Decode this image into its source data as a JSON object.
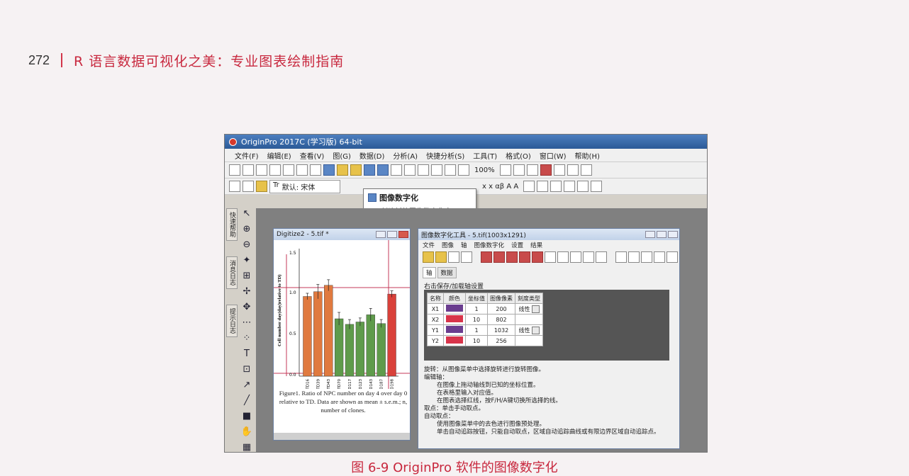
{
  "page": {
    "page_number": "272",
    "book_title": "R 语言数据可视化之美：专业图表绘制指南",
    "caption": "图 6-9 OriginPro 软件的图像数字化"
  },
  "app": {
    "title": "OriginPro 2017C (学习版) 64-bit",
    "menu": [
      "文件(F)",
      "编辑(E)",
      "查看(V)",
      "图(G)",
      "数据(D)",
      "分析(A)",
      "快捷分析(S)",
      "工具(T)",
      "格式(O)",
      "窗口(W)",
      "帮助(H)"
    ],
    "zoom": "100%",
    "font_name": "默认: 宋体",
    "format_symbols": "x  x  αβ  A  A"
  },
  "tooltip": {
    "title": "图像数字化",
    "description": "创建新的图像数字化窗口"
  },
  "side_tabs": [
    "快速帮助",
    "消息日志",
    "提示日志"
  ],
  "graph_window": {
    "title": "Digitize2 - 5.tif *",
    "y_label": "Cell number day(day)relative to TD)",
    "y_ticks": [
      "1.5",
      "1.0",
      "0.5",
      "0.0"
    ],
    "figure_caption": "Figure1. Ratio of NPC number on day 4 over day 0 relative to TD. Data are shown as mean ± s.e.m.; n, number of clones."
  },
  "chart_data": {
    "type": "bar",
    "categories": [
      "TD16",
      "TD39",
      "TD43",
      "TD70",
      "TD117",
      "TD123",
      "TD143",
      "TD187",
      "TD198"
    ],
    "values": [
      1.0,
      1.06,
      1.14,
      0.72,
      0.65,
      0.68,
      0.77,
      0.66,
      1.03
    ],
    "errors": [
      0.04,
      0.09,
      0.07,
      0.08,
      0.06,
      0.05,
      0.08,
      0.05,
      0.04
    ],
    "ylim": [
      0,
      1.6
    ],
    "colors": [
      "#e07a3f",
      "#e07a3f",
      "#e07a3f",
      "#5f9b4b",
      "#5f9b4b",
      "#5f9b4b",
      "#5f9b4b",
      "#5f9b4b",
      "#d9413a"
    ]
  },
  "digitizer": {
    "title": "图像数字化工具 - 5.tif(1003x1291)",
    "menu": [
      "文件",
      "图像",
      "轴",
      "图像数字化",
      "设置",
      "结果"
    ],
    "tabs": [
      "轴",
      "数据"
    ],
    "section": "右击保存/加载轴设置",
    "columns": [
      "名称",
      "颜色",
      "坐标值",
      "图像像素",
      "刻度类型"
    ],
    "rows": [
      {
        "name": "X1",
        "color": "#6a3d8f",
        "value": "1",
        "pixel": "200",
        "scale": "线性"
      },
      {
        "name": "X2",
        "color": "#d8344a",
        "value": "10",
        "pixel": "802",
        "scale": ""
      },
      {
        "name": "Y1",
        "color": "#6a3d8f",
        "value": "1",
        "pixel": "1032",
        "scale": "线性"
      },
      {
        "name": "Y2",
        "color": "#d8344a",
        "value": "10",
        "pixel": "256",
        "scale": ""
      }
    ],
    "help_lines": [
      "旋转：从图像菜单中选择旋转进行旋转图像。",
      "编辑轴：",
      "在图像上拖动轴线到已知的坐标位置。",
      "在表格里输入对应值。",
      "在图表选择红线，按F/H/A键切换所选择的线。",
      "取点：单击手动取点。",
      "自动取点：",
      "使用图像菜单中的去色进行图像预处理。",
      "单击自动追踪按钮，只能自动取点，区域自动追踪曲线或有限边界区域自动追踪点。"
    ]
  }
}
